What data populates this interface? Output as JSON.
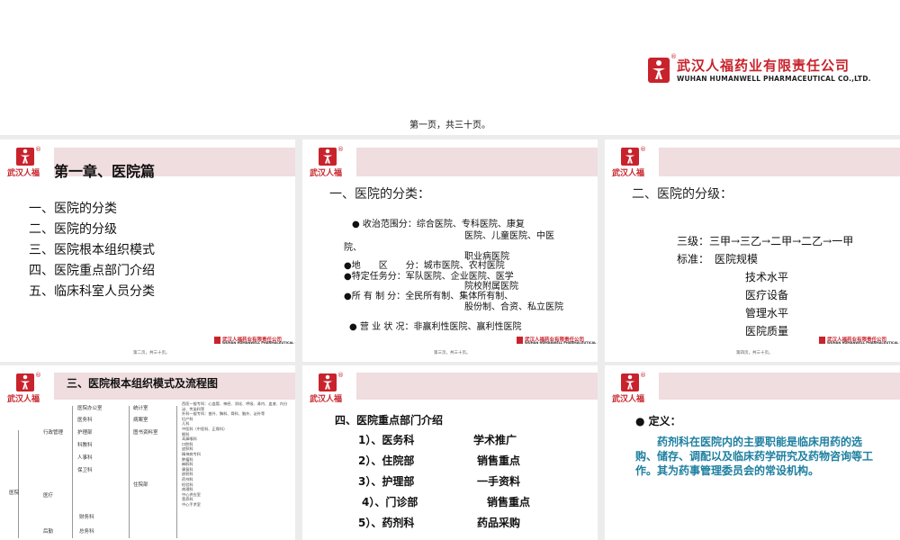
{
  "header": {
    "company_cn": "武汉人福药业有限责任公司",
    "company_en": "WUHAN HUMANWELL PHARMACEUTICAL CO.,LTD.",
    "reg_mark": "®",
    "page_caption": "第一页，共三十页。"
  },
  "brand": {
    "short_cn": "武汉人福",
    "accent": "#c8232c",
    "band": "#f0dde0",
    "definition_color": "#1d7fa0"
  },
  "slide1": {
    "title": "第一章、医院篇",
    "items": [
      "一、医院的分类",
      "二、医院的分级",
      "三、医院根本组织模式",
      "四、医院重点部门介绍",
      "五、临床科室人员分类"
    ],
    "footer_page": "第二页，共三十页。"
  },
  "slide2": {
    "heading": "一、医院的分类：",
    "lines": [
      "● 收治范围分：综合医院、专科医院、康复",
      "医院、儿童医院、中医",
      "院、",
      "职业病医院",
      "●地　　区　　分：城市医院、农村医院",
      "●特定任务分：军队医院、企业医院、医学",
      "院校附属医院",
      "●所 有 制 分：全民所有制、集体所有制、",
      "股份制、合资、私立医院",
      "● 营 业 状 况：非赢利性医院、赢利性医院"
    ],
    "footer_page": "第三页，共三十页。"
  },
  "slide3": {
    "heading": "二、医院的分级：",
    "levels": "三级：三甲→三乙→二甲→二乙→一甲",
    "standard_label": "标准：",
    "standards": [
      "医院规模",
      "技术水平",
      "医疗设备",
      "管理水平",
      "医院质量"
    ],
    "footer_page": "第四页，共三十页。"
  },
  "slide4": {
    "title": "三、医院根本组织模式及流程图",
    "col1": [
      "医院",
      "行政管理",
      "医疗",
      "后勤"
    ],
    "col2": [
      "医院办公室",
      "医务科",
      "护理部",
      "科教科",
      "人事科",
      "保卫科",
      "财务科",
      "总务科"
    ],
    "col3": [
      "统计室",
      "病案室",
      "图书资料室",
      "住院部"
    ],
    "col4": [
      "西医一般专科：心血管、神经、消化、呼吸、肾内、血液、内分泌、传染科等",
      "外科一般专科：普外、胸科、骨科、脑外、泌外等",
      "妇产科",
      "儿科",
      "中医科（中医科、正骨科）",
      "眼科",
      "耳鼻喉科",
      "口腔科",
      "皮肤科",
      "精神病专科",
      "肿瘤科",
      "麻醉科",
      "康复科",
      "放射科",
      "药剂科",
      "检验科",
      "病理科",
      "中心供应室",
      "营养科",
      "中心手术室"
    ]
  },
  "slide5": {
    "title": "四、医院重点部门介绍",
    "departments": [
      {
        "name": "1）、医务科",
        "purpose": "学术推广"
      },
      {
        "name": "2）、住院部",
        "purpose": "销售重点"
      },
      {
        "name": "3）、护理部",
        "purpose": "一手资料"
      },
      {
        "name": "4）、门诊部",
        "purpose": "销售重点"
      },
      {
        "name": "5）、药剂科",
        "purpose": "药品采购"
      }
    ]
  },
  "slide6": {
    "label": "● 定义：",
    "text": "药剂科在医院内的主要职能是临床用药的选购、储存、调配以及临床药学研究及药物咨询等工作。其为药事管理委员会的常设机构。"
  }
}
